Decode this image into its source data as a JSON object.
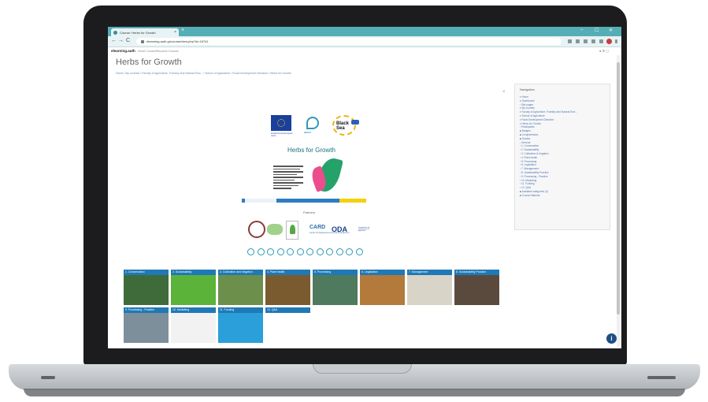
{
  "browser": {
    "tab_title": "Course: Herbs for Growth",
    "tab_close": "×",
    "new_tab": "+",
    "url": "elearning.auth.gr/course/view.php?id=16741",
    "window_controls": {
      "minimize": "–",
      "maximize": "☐",
      "close": "✕"
    },
    "nav": {
      "back": "←",
      "forward": "→",
      "reload": "C"
    }
  },
  "site": {
    "brand": "elearning.auth",
    "nav_text": "Home   Course/Resource   Courses",
    "right_text": "● ⚙ ▢"
  },
  "page": {
    "title": "Herbs for Growth",
    "breadcrumb": "Home / My courses / Faculty of Agriculture, Forestry and Natural Envi... / School of Agriculture / Rural Development Direction / Herbs for Growth",
    "close": "×"
  },
  "banner": {
    "eu_caption": "Funded by the European Union",
    "herbs_caption": "HEGO",
    "blacksea_text": "Black Sea"
  },
  "poster": {
    "title": "Herbs for Growth"
  },
  "partners": {
    "label": "Partners",
    "card": "CARD",
    "card_sub": "Center for Agribusiness & Rural Development",
    "oda": "ODA",
    "oda_sub": "Organization for Development of Agriculture"
  },
  "tiles": [
    {
      "label": "1. Conservation",
      "color": "#3f6b3a"
    },
    {
      "label": "2. Sustainability",
      "color": "#5bb33a"
    },
    {
      "label": "3. Cultivation and Irrigation",
      "color": "#6d8f4c"
    },
    {
      "label": "4. Plant health",
      "color": "#7a5a2f"
    },
    {
      "label": "5. Processing",
      "color": "#4f7a5e"
    },
    {
      "label": "6. Legislation",
      "color": "#b37a3b"
    },
    {
      "label": "7. Management",
      "color": "#d8d4c8"
    },
    {
      "label": "8. Sustainability Practice",
      "color": "#5a4a3e"
    },
    {
      "label": "9. Processing - Practice",
      "color": "#7d8f9a"
    },
    {
      "label": "10. Marketing",
      "color": "#f2f2f2"
    },
    {
      "label": "11. Funding",
      "color": "#2b9fd9"
    },
    {
      "label": "12. Q&A",
      "color": "#ffffff"
    }
  ],
  "sidebar": {
    "title": "Navigation",
    "items": [
      "▾ Home",
      "  ● Dashboard",
      "  › Site pages",
      "  ▾ My courses",
      "    ▾ Faculty of Agriculture, Forestry and Natural Envi...",
      "      ▾ School of Agriculture",
      "        ▾ Rural Development Direction",
      "          ▾ Herbs for Growth",
      "            › Participants",
      "            ■ Badges",
      "            ■ Competencies",
      "            ■ Grades",
      "            › General",
      "            › 1. Conservation",
      "            › 2. Sustainability",
      "            › 3. Cultivation & Irrigation",
      "            › 4. Plant health",
      "            › 5. Processing",
      "            › 6. Legislation",
      "            › 7. Management",
      "            › 8. Sustainability Practice",
      "            › 9. Processing - Practice",
      "            › 10. Marketing",
      "            › 11. Funding",
      "            › 12. Q&A",
      "            ■ Available categories (4)",
      "            ■ Course Material"
    ]
  },
  "help": "i"
}
